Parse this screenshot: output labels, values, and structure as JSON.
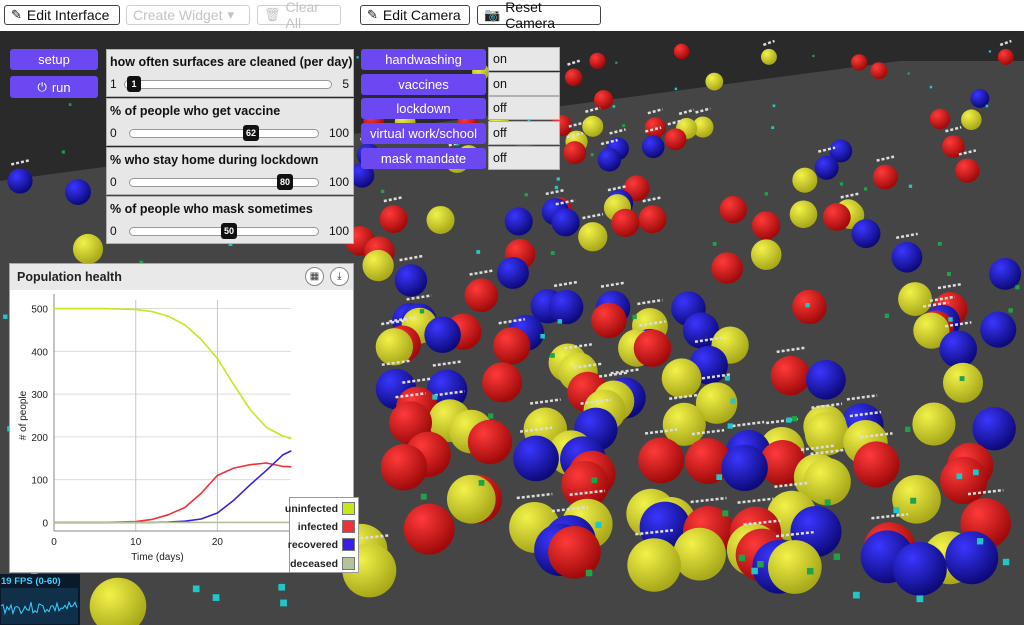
{
  "toolbar": {
    "edit_interface": "Edit Interface",
    "create_widget": "Create Widget",
    "clear_all": "Clear All",
    "edit_camera": "Edit Camera",
    "reset_camera": "Reset Camera"
  },
  "buttons": {
    "setup": "setup",
    "run": "run"
  },
  "sliders": [
    {
      "label": "how often surfaces are cleaned (per day)",
      "min": "1",
      "max": "5",
      "value": "1"
    },
    {
      "label": "% of people who get vaccine",
      "min": "0",
      "max": "100",
      "value": "62"
    },
    {
      "label": "% who stay home during lockdown",
      "min": "0",
      "max": "100",
      "value": "80"
    },
    {
      "label": "% of people who mask sometimes",
      "min": "0",
      "max": "100",
      "value": "50"
    }
  ],
  "switches": [
    {
      "label": "handwashing",
      "state": "on"
    },
    {
      "label": "vaccines",
      "state": "on"
    },
    {
      "label": "lockdown",
      "state": "off"
    },
    {
      "label": "virtual work/school",
      "state": "off"
    },
    {
      "label": "mask mandate",
      "state": "off"
    }
  ],
  "plot": {
    "title": "Population health"
  },
  "chart_data": {
    "type": "line",
    "xlabel": "Time (days)",
    "ylabel": "# of people",
    "xlim": [
      0,
      29
    ],
    "ylim": [
      -20,
      520
    ],
    "xticks": [
      "0",
      "10",
      "20"
    ],
    "yticks": [
      "0",
      "100",
      "200",
      "300",
      "400",
      "500"
    ],
    "grid": true,
    "legend_position": "bottom-right",
    "series": [
      {
        "name": "uninfected",
        "color": "#c8e61e",
        "x": [
          0,
          2,
          4,
          6,
          8,
          10,
          12,
          14,
          16,
          18,
          20,
          22,
          24,
          26,
          28,
          29
        ],
        "y": [
          500,
          500,
          500,
          500,
          499,
          498,
          493,
          482,
          462,
          428,
          383,
          322,
          264,
          222,
          202,
          196
        ]
      },
      {
        "name": "infected",
        "color": "#f0303a",
        "x": [
          0,
          2,
          4,
          6,
          8,
          10,
          12,
          14,
          16,
          18,
          20,
          22,
          24,
          26,
          28,
          29
        ],
        "y": [
          0,
          0,
          0,
          0,
          1,
          2,
          7,
          18,
          35,
          68,
          110,
          127,
          135,
          139,
          131,
          130
        ]
      },
      {
        "name": "recovered",
        "color": "#3a1fe6",
        "x": [
          0,
          2,
          4,
          6,
          8,
          10,
          12,
          14,
          16,
          18,
          20,
          22,
          24,
          26,
          28,
          29
        ],
        "y": [
          0,
          0,
          0,
          0,
          0,
          0,
          0,
          1,
          3,
          8,
          22,
          52,
          88,
          122,
          158,
          167
        ]
      },
      {
        "name": "deceased",
        "color": "#b5c29e",
        "x": [
          0,
          29
        ],
        "y": [
          0,
          0
        ]
      }
    ]
  },
  "fps": {
    "label": "19 FPS (0-60)"
  }
}
